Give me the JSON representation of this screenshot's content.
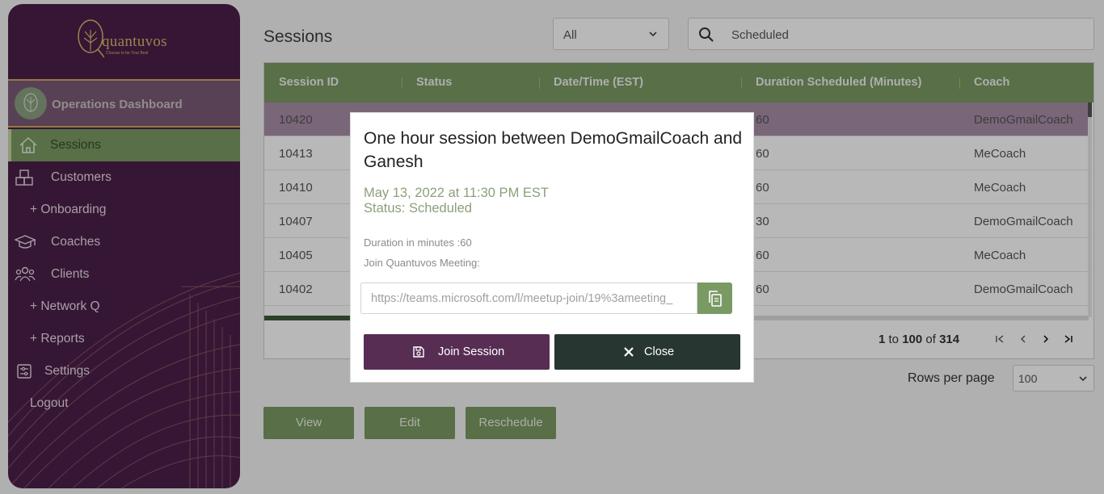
{
  "sidebar": {
    "logo_text": "quantuvos",
    "logo_tagline": "Choose to be Your Best",
    "dashboard_label": "Operations Dashboard",
    "items": [
      {
        "label": "Sessions",
        "icon": "home-icon"
      },
      {
        "label": "Customers",
        "icon": "boxes-icon"
      },
      {
        "label": "+ Onboarding"
      },
      {
        "label": "Coaches",
        "icon": "graduation-cap-icon"
      },
      {
        "label": "Clients",
        "icon": "users-icon"
      },
      {
        "label": "+ Network Q"
      },
      {
        "label": "+ Reports"
      },
      {
        "label": "Settings",
        "icon": "settings-icon"
      },
      {
        "label": "Logout"
      }
    ]
  },
  "main": {
    "title": "Sessions",
    "filter_value": "All",
    "search_value": "Scheduled",
    "columns": [
      "Session ID",
      "Status",
      "Date/Time (EST)",
      "Duration Scheduled (Minutes)",
      "Coach"
    ],
    "rows": [
      {
        "id": "10420",
        "duration": "60",
        "coach": "DemoGmailCoach"
      },
      {
        "id": "10413",
        "duration": "60",
        "coach": "MeCoach"
      },
      {
        "id": "10410",
        "duration": "60",
        "coach": "MeCoach"
      },
      {
        "id": "10407",
        "duration": "30",
        "coach": "DemoGmailCoach"
      },
      {
        "id": "10405",
        "duration": "60",
        "coach": "MeCoach"
      },
      {
        "id": "10402",
        "duration": "60",
        "coach": "DemoGmailCoach"
      }
    ],
    "pager": {
      "from": "1",
      "to_word": "to",
      "to": "100",
      "of_word": "of",
      "total": "314"
    },
    "rows_per_page_label": "Rows per page",
    "rows_per_page_value": "100",
    "buttons": {
      "view": "View",
      "edit": "Edit",
      "reschedule": "Reschedule"
    }
  },
  "modal": {
    "title": "One hour session between DemoGmailCoach and Ganesh",
    "date": "May 13, 2022 at 11:30 PM EST",
    "status": "Status: Scheduled",
    "duration": "Duration in minutes :60",
    "join_label": "Join Quantuvos Meeting:",
    "link": "https://teams.microsoft.com/l/meetup-join/19%3ameeting_",
    "join_button": "Join Session",
    "close_button": "Close"
  },
  "colors": {
    "sidebar": "#4b1f4a",
    "accent_green": "#7a9a63",
    "join_button": "#572d53",
    "close_button": "#283631",
    "gold": "#d9b86a"
  }
}
